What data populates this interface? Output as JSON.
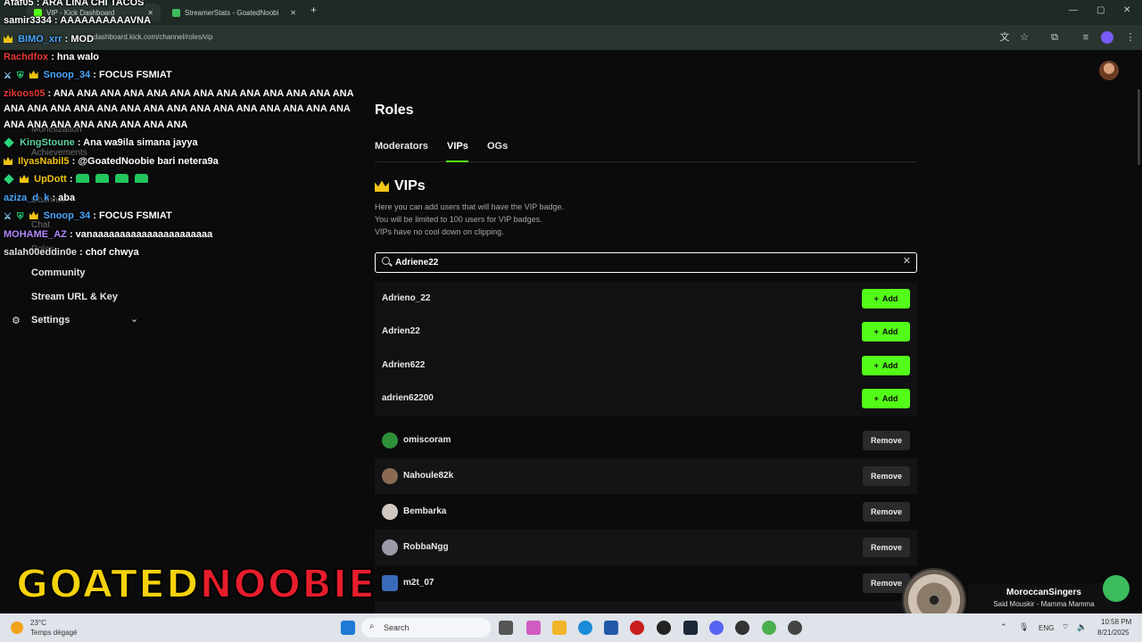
{
  "browser": {
    "tabs": [
      {
        "title": "VIP - Kick Dashboard",
        "active": true
      },
      {
        "title": "StreamerStats - GoatedNoobi",
        "active": false
      }
    ],
    "new_tab": "+",
    "url": "dashboard.kick.com/channel/roles/vip",
    "controls": [
      "—",
      "▢",
      "✕"
    ],
    "toolbar_icons": [
      "translate-icon",
      "star-icon",
      "extensions-icon",
      "media-icon",
      "profile-icon",
      "menu-icon"
    ]
  },
  "sidebar": {
    "ghost_items": [
      "Monetization",
      "Achievements",
      "Channel",
      "Chat",
      "Roles"
    ],
    "items": [
      {
        "label": "Community"
      },
      {
        "label": "Stream URL & Key"
      },
      {
        "label": "Settings"
      }
    ]
  },
  "chat": [
    {
      "user": "Afaf05",
      "color": "#ffffff",
      "badges": [],
      "message": ": ARA LINA CHI TACOS"
    },
    {
      "user": "samir3334",
      "color": "#ffffff",
      "badges": [],
      "message": ": AAAAAAAAAAVNA"
    },
    {
      "user": "BIMO_xrr",
      "color": "#4aa8ff",
      "badges": [
        "crown"
      ],
      "message": ": MOD"
    },
    {
      "user": "Rachdfox",
      "color": "#e53935",
      "badges": [],
      "message": ": hna walo"
    },
    {
      "user": "Snoop_34",
      "color": "#4aa8ff",
      "badges": [
        "sword",
        "shield",
        "crown"
      ],
      "message": ": FOCUS FSMIAT"
    },
    {
      "user": "zikoos05",
      "color": "#e53935",
      "badges": [],
      "message": ": ANA ANA ANA ANA ANA ANA ANA ANA ANA ANA ANA ANA ANA"
    },
    {
      "user": "",
      "color": "#ffffff",
      "badges": [],
      "message": "ANA ANA ANA ANA ANA ANA ANA ANA ANA ANA ANA ANA ANA ANA ANA"
    },
    {
      "user": "",
      "color": "#ffffff",
      "badges": [],
      "message": "ANA ANA ANA ANA ANA ANA ANA ANA"
    },
    {
      "user": "KingStoune",
      "color": "#5fd3a0",
      "badges": [
        "diamond"
      ],
      "message": ": Ana wa9ila simana jayya"
    },
    {
      "user": "IlyasNabil5",
      "color": "#f1c40f",
      "badges": [
        "crown"
      ],
      "message": ": @GoatedNoobie bari netera9a"
    },
    {
      "user": "UpDott",
      "color": "#f1c40f",
      "badges": [
        "diamond",
        "crown"
      ],
      "message": ":"
    },
    {
      "user": "aziza_d_k",
      "color": "#4aa8ff",
      "badges": [],
      "message": ": aba"
    },
    {
      "user": "Snoop_34",
      "color": "#4aa8ff",
      "badges": [
        "sword",
        "shield",
        "crown"
      ],
      "message": ": FOCUS FSMIAT"
    },
    {
      "user": "MOHAME_AZ",
      "color": "#b388ff",
      "badges": [],
      "message": ": vanaaaaaaaaaaaaaaaaaaaaaa"
    },
    {
      "user": "salah00eddin0e",
      "color": "#e0e0e0",
      "badges": [],
      "message": ": chof chwya"
    }
  ],
  "roles": {
    "title": "Roles",
    "tabs": [
      "Moderators",
      "VIPs",
      "OGs"
    ],
    "active_tab": "VIPs",
    "vip_heading": "VIPs",
    "description": [
      "Here you can add users that will have the VIP badge.",
      "You will be limited to 100 users for VIP badges.",
      "VIPs have no cool down on clipping."
    ],
    "search": {
      "value": "Adriene22",
      "clear": "✕"
    },
    "results": [
      {
        "name": "Adrieno_22",
        "action": "Add"
      },
      {
        "name": "Adrien22",
        "action": "Add"
      },
      {
        "name": "Adrien622",
        "action": "Add"
      },
      {
        "name": "adrien62200",
        "action": "Add"
      }
    ],
    "vips": [
      {
        "name": "omiscoram",
        "action": "Remove",
        "avatar_color": "#2f8f3a"
      },
      {
        "name": "Nahoule82k",
        "action": "Remove",
        "avatar_color": "#8a6a52"
      },
      {
        "name": "Bembarka",
        "action": "Remove",
        "avatar_color": "#cfc8c2"
      },
      {
        "name": "RobbaNgg",
        "action": "Remove",
        "avatar_color": "#9a9aa8"
      },
      {
        "name": "m2t_07",
        "action": "Remove",
        "avatar_color": "#3a6bb8"
      }
    ]
  },
  "overlay": {
    "logo_gold": "GOATED",
    "logo_red": "NOOBIE",
    "music_title": "MoroccanSingers",
    "music_sub": "Said Mouskir - Mamma Mamma"
  },
  "taskbar": {
    "weather_temp": "23°C",
    "weather_desc": "Temps dégagé",
    "search_placeholder": "Search",
    "lang": "ENG",
    "time": "10:58 PM",
    "date": "8/21/2025"
  },
  "colors": {
    "accent": "#53fc18",
    "background": "#0b0b0c",
    "crown": "#f5c518"
  }
}
